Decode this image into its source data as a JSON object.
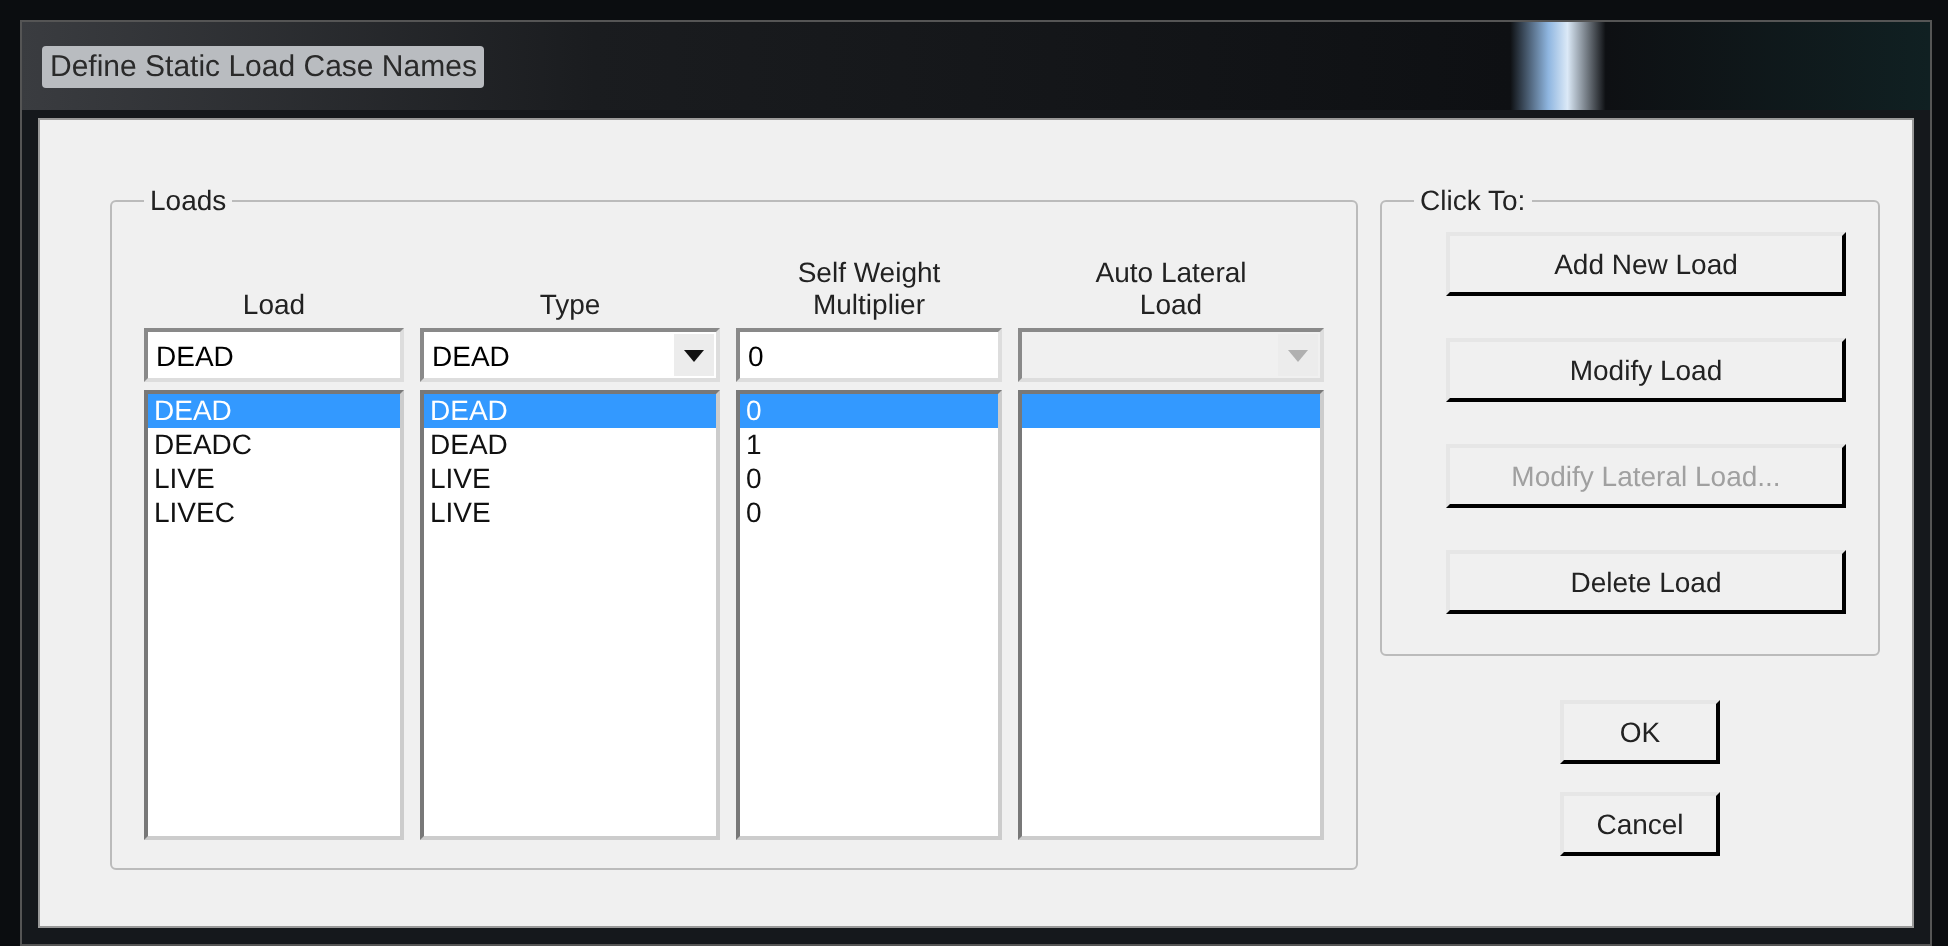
{
  "window": {
    "title": "Define Static Load Case Names"
  },
  "loads_group": {
    "label": "Loads",
    "columns": [
      {
        "label": "Load"
      },
      {
        "label": "Type"
      },
      {
        "label": "Self Weight Multiplier"
      },
      {
        "label": "Auto Lateral Load"
      }
    ],
    "inputs": {
      "load": "DEAD",
      "type": "DEAD",
      "multiplier": "0",
      "auto_lateral_disabled": true
    },
    "rows": [
      {
        "load": "DEAD",
        "type": "DEAD",
        "multiplier": "0",
        "selected": true
      },
      {
        "load": "DEADC",
        "type": "DEAD",
        "multiplier": "1",
        "selected": false
      },
      {
        "load": "LIVE",
        "type": "LIVE",
        "multiplier": "0",
        "selected": false
      },
      {
        "load": "LIVEC",
        "type": "LIVE",
        "multiplier": "0",
        "selected": false
      }
    ]
  },
  "click_to_group": {
    "label": "Click To:",
    "buttons": [
      {
        "label": "Add New Load",
        "disabled": false
      },
      {
        "label": "Modify Load",
        "disabled": false
      },
      {
        "label": "Modify Lateral Load...",
        "disabled": true
      },
      {
        "label": "Delete Load",
        "disabled": false
      }
    ]
  },
  "buttons": [
    {
      "label": "OK"
    },
    {
      "label": "Cancel"
    }
  ]
}
